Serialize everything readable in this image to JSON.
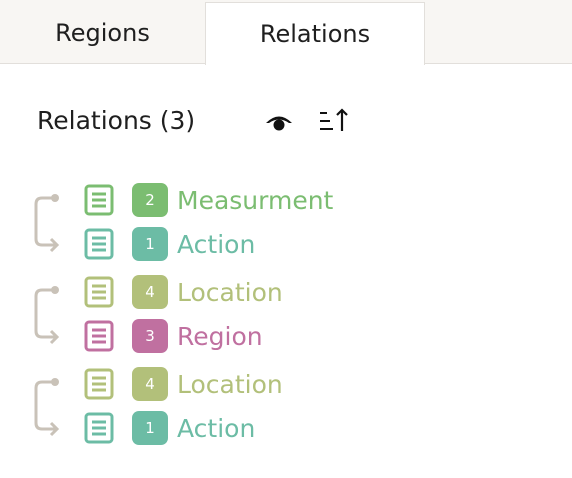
{
  "tabs": [
    {
      "label": "Regions",
      "active": false
    },
    {
      "label": "Relations",
      "active": true
    }
  ],
  "panel": {
    "title": "Relations (3)"
  },
  "icons": {
    "visibility": "eye-icon",
    "sort": "sort-ascending-icon",
    "document": "document-icon"
  },
  "colors": {
    "Measurment": "#7bbd71",
    "Action": "#6cbca5",
    "Location": "#b2c07a",
    "Region": "#c070a0",
    "connector": "#c9c2b8"
  },
  "relations": [
    {
      "from": {
        "label": "Measurment",
        "badge": "2"
      },
      "to": {
        "label": "Action",
        "badge": "1"
      }
    },
    {
      "from": {
        "label": "Location",
        "badge": "4"
      },
      "to": {
        "label": "Region",
        "badge": "3"
      }
    },
    {
      "from": {
        "label": "Location",
        "badge": "4"
      },
      "to": {
        "label": "Action",
        "badge": "1"
      }
    }
  ]
}
